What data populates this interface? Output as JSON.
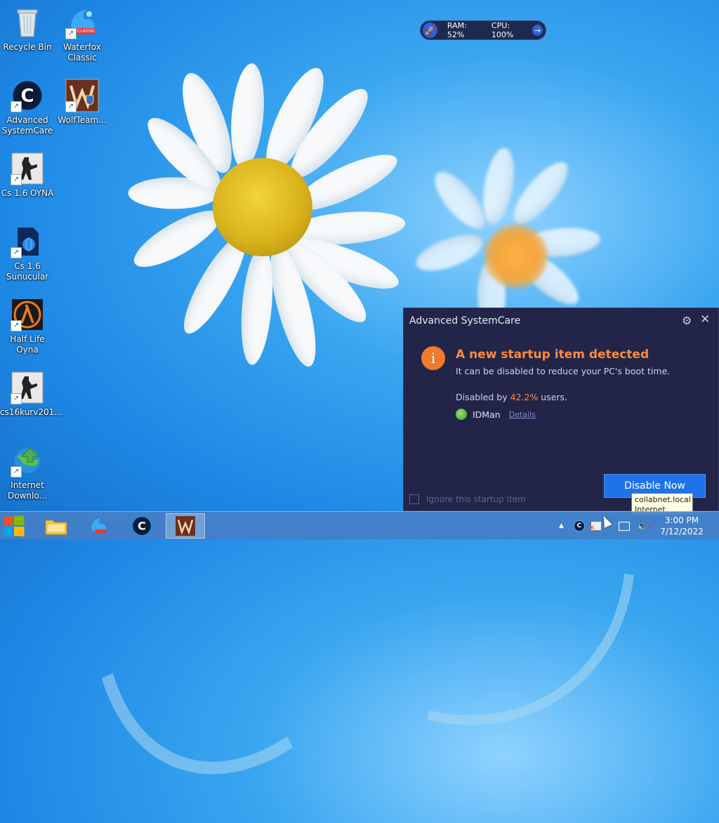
{
  "desktop_icons": [
    {
      "id": "recycle-bin",
      "label": "Recycle Bin"
    },
    {
      "id": "waterfox",
      "label": "Waterfox Classic",
      "badge": "CLASSIC"
    },
    {
      "id": "advanced-systemcare",
      "label": "Advanced SystemCare"
    },
    {
      "id": "wolfteam",
      "label": "WolfTeam..."
    },
    {
      "id": "cs-oyna",
      "label": "Cs 1.6 OYNA"
    },
    {
      "id": "cs-sunucular",
      "label": "Cs 1.6 Sunucular"
    },
    {
      "id": "half-life",
      "label": "Half Life Oyna"
    },
    {
      "id": "cs16kurv",
      "label": "cs16kurv201..."
    },
    {
      "id": "internet-download",
      "label": "Internet Downlo..."
    }
  ],
  "sys_widget": {
    "ram_label": "RAM: 52%",
    "cpu_label": "CPU: 100%"
  },
  "popup": {
    "title": "Advanced SystemCare",
    "heading": "A new startup item detected",
    "subtext": "It can be disabled to reduce your PC's boot time.",
    "disabled_prefix": "Disabled by ",
    "disabled_pct": "42.2%",
    "disabled_suffix": " users.",
    "app_name": "IDMan",
    "details_link": "Details",
    "disable_button": "Disable Now",
    "ignore_label": "Ignore this startup item"
  },
  "tooltip": {
    "line1": "collabnet.local",
    "line2": "Internet access"
  },
  "clock": {
    "time": "3:00 PM",
    "date": "7/12/2022"
  },
  "colors": {
    "accent": "#1f73e8",
    "warning": "#f07a2c",
    "popup_bg": "#232548"
  }
}
